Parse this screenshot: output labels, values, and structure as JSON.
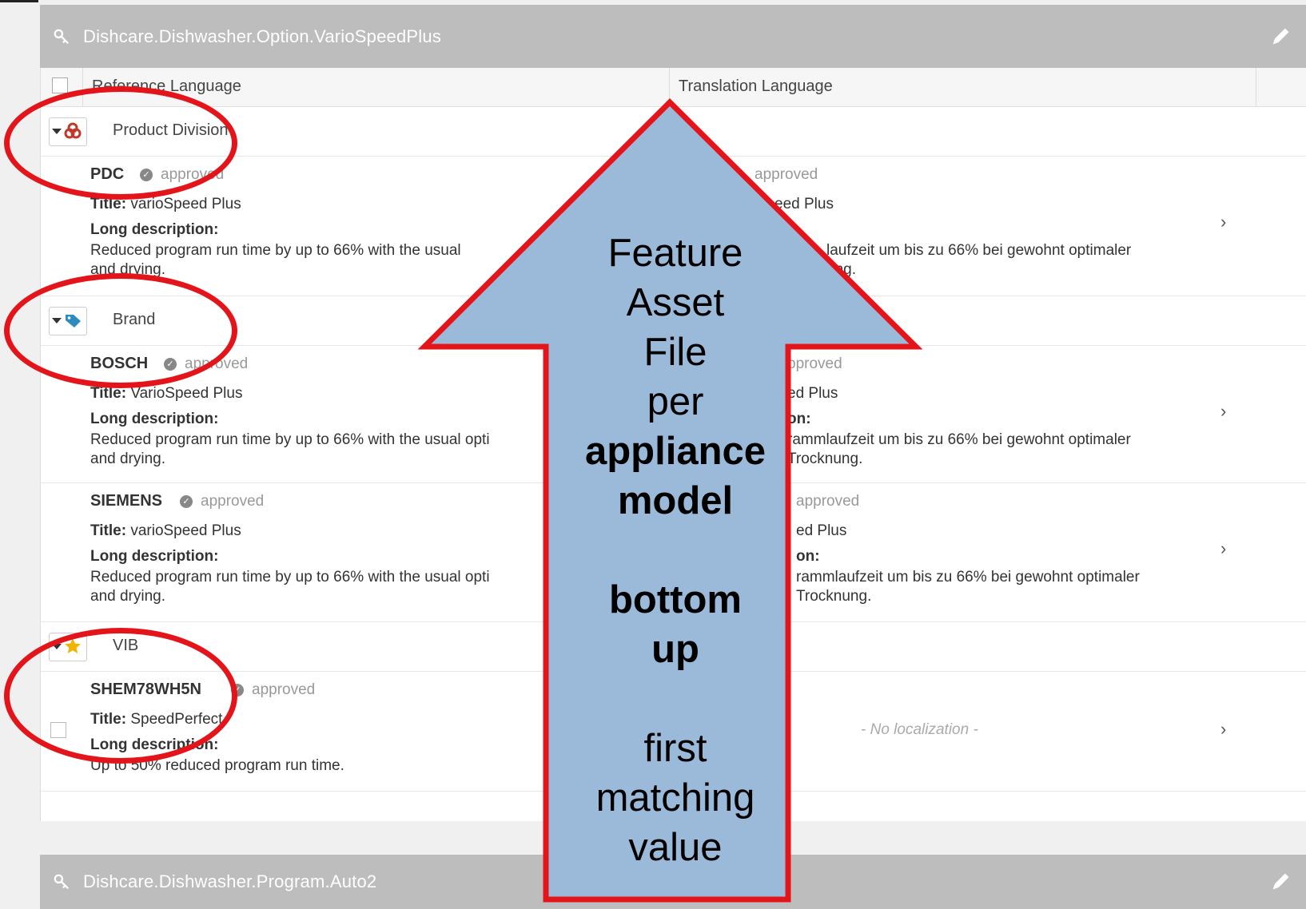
{
  "header_top": {
    "title": "Dishcare.Dishwasher.Option.VarioSpeedPlus",
    "icon": "key-icon",
    "edit_icon": "pencil-icon"
  },
  "header_bottom": {
    "title": "Dishcare.Dishwasher.Program.Auto2",
    "icon": "key-icon",
    "edit_icon": "pencil-icon"
  },
  "columns": {
    "reference": "Reference Language",
    "translation": "Translation Language"
  },
  "groups": [
    {
      "label": "Product Division",
      "icon": "product-division-icon"
    },
    {
      "label": "Brand",
      "icon": "tag-icon"
    },
    {
      "label": "VIB",
      "icon": "star-icon"
    }
  ],
  "entries": [
    {
      "code": "PDC",
      "status": "approved",
      "title_label": "Title:",
      "title": "varioSpeed Plus",
      "long_label": "Long description:",
      "desc1": "Reduced program run time by up to 66% with the usual",
      "desc2": "and drying.",
      "t_status": "approved",
      "t_title": "eed Plus",
      "t_long": "n:",
      "t_desc1": "laufzeit um bis zu 66% bei gewohnt optimaler",
      "t_desc2": "ung."
    },
    {
      "code": "BOSCH",
      "status": "approved",
      "title_label": "Title:",
      "title": "VarioSpeed Plus",
      "long_label": "Long description:",
      "desc1": "Reduced program run time by up to 66% with the usual opti",
      "desc2": "and drying.",
      "t_status": "pproved",
      "t_title": "ed Plus",
      "t_long": "on:",
      "t_desc1": "rammlaufzeit um bis zu 66% bei gewohnt optimaler",
      "t_desc2": "Trocknung."
    },
    {
      "code": "SIEMENS",
      "status": "approved",
      "title_label": "Title:",
      "title": "varioSpeed Plus",
      "long_label": "Long description:",
      "desc1": "Reduced program run time by up to 66% with the usual opti",
      "desc2": "and drying.",
      "t_status": "approved",
      "t_title": "ed Plus",
      "t_long": "on:",
      "t_desc1": "rammlaufzeit um bis zu 66% bei gewohnt optimaler",
      "t_desc2": "Trocknung."
    },
    {
      "code": "SHEM78WH5N",
      "status": "approved",
      "title_label": "Title:",
      "title": "SpeedPerfect",
      "long_label": "Long description:",
      "desc1": "Up to 50% reduced program run time.",
      "no_localization": "- No localization -"
    }
  ],
  "chevron": "›",
  "arrow": {
    "line1": "Feature",
    "line2": "Asset",
    "line3": "File",
    "line4": "per",
    "line5": "appliance",
    "line6": "model",
    "line7": "bottom",
    "line8": "up",
    "line9": "first",
    "line10": "matching",
    "line11": "value",
    "fill": "#9bbad9",
    "stroke": "#e3151b"
  },
  "annotation_color": "#e3151b"
}
